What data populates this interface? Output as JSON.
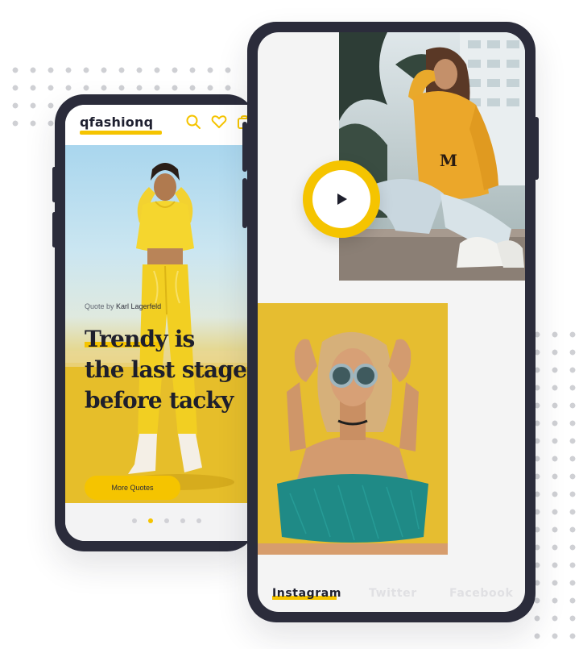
{
  "colors": {
    "accent": "#f5c400",
    "phone_frame": "#2b2c3b",
    "dark_text": "#1e1f2c",
    "muted_text": "#e0e0e3"
  },
  "left_app": {
    "logo": "qfashionq",
    "header_icons": [
      "search-icon",
      "heart-icon",
      "bag-icon"
    ],
    "quote_by_prefix": "Quote by",
    "quote_author": "Karl Lagerfeld",
    "quote_text": "Trendy is\nthe last stage\nbefore tacky",
    "more_quotes_button": "More Quotes",
    "pager": {
      "count": 5,
      "active_index": 1
    }
  },
  "right_app": {
    "play_icon": "play-icon",
    "social_tabs": [
      {
        "label": "Instagram",
        "active": true
      },
      {
        "label": "Twitter",
        "active": false
      },
      {
        "label": "Facebook",
        "active": false
      }
    ]
  }
}
